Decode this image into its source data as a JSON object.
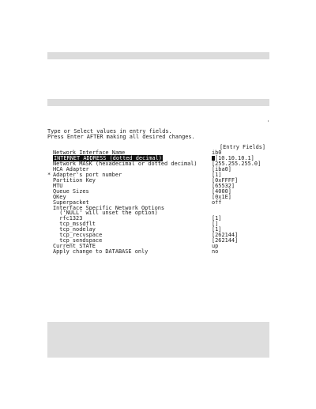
{
  "instructions": [
    "Type or Select values in entry fields.",
    "Press Enter AFTER making all desired changes."
  ],
  "header": "[Entry Fields]",
  "stray_mark": "'",
  "fields": [
    {
      "label": "Network Interface Name",
      "value": "ib0",
      "required": "",
      "highlight": false
    },
    {
      "label": "INTERNET ADDRESS (dotted decimal)",
      "value": "[10.10.10.1]",
      "required": "",
      "highlight": true
    },
    {
      "label": "Network MASK (hexadecimal or dotted decimal)",
      "value": "[255.255.255.0]",
      "required": "",
      "highlight": false
    },
    {
      "label": "HCA Adapter",
      "value": "[iba0]",
      "required": "",
      "highlight": false
    },
    {
      "label": "Adapter's port number",
      "value": "[1]",
      "required": "*",
      "highlight": false
    },
    {
      "label": "Partition Key",
      "value": "[0xFFFF]",
      "required": "",
      "highlight": false
    },
    {
      "label": "MTU",
      "value": "[65532]",
      "required": "",
      "highlight": false
    },
    {
      "label": "Queue Sizes",
      "value": "[4000]",
      "required": "",
      "highlight": false
    },
    {
      "label": "QKey",
      "value": "[0x1E]",
      "required": "",
      "highlight": false
    },
    {
      "label": "Superpacket",
      "value": "off",
      "required": "",
      "highlight": false
    },
    {
      "label": "Interface Specific Network Options",
      "value": "",
      "required": "",
      "highlight": false
    },
    {
      "label": "  ('NULL' will unset the option)",
      "value": "",
      "required": "",
      "highlight": false
    },
    {
      "label": "  rfc1323",
      "value": "[1]",
      "required": "",
      "highlight": false
    },
    {
      "label": "  tcp_mssdflt",
      "value": "[]",
      "required": "",
      "highlight": false
    },
    {
      "label": "  tcp_nodelay",
      "value": "[1]",
      "required": "",
      "highlight": false
    },
    {
      "label": "  tcp_recvspace",
      "value": "[262144]",
      "required": "",
      "highlight": false
    },
    {
      "label": "  tcp_sendspace",
      "value": "[262144]",
      "required": "",
      "highlight": false
    },
    {
      "label": "Current STATE",
      "value": "up",
      "required": "",
      "highlight": false
    },
    {
      "label": "Apply change to DATABASE only",
      "value": "no",
      "required": "",
      "highlight": false
    }
  ]
}
